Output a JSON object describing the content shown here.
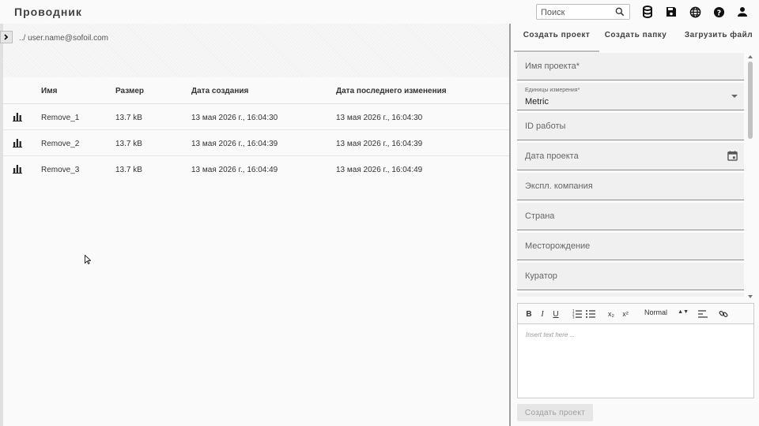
{
  "app": {
    "title": "Проводник"
  },
  "search": {
    "placeholder": "Поиск"
  },
  "header_icons": [
    "database-icon",
    "save-icon",
    "globe-icon",
    "help-icon",
    "account-icon"
  ],
  "breadcrumb": {
    "path": "../ user.name@sofoil.com"
  },
  "table": {
    "columns": [
      "Имя",
      "Размер",
      "Дата создания",
      "Дата последнего изменения"
    ],
    "rows": [
      {
        "name": "Remove_1",
        "size": "13.7 kB",
        "created": "13 мая 2026 г., 16:04:30",
        "modified": "13 мая 2026 г., 16:04:30"
      },
      {
        "name": "Remove_2",
        "size": "13.7 kB",
        "created": "13 мая 2026 г., 16:04:39",
        "modified": "13 мая 2026 г., 16:04:39"
      },
      {
        "name": "Remove_3",
        "size": "13.7 kB",
        "created": "13 мая 2026 г., 16:04:49",
        "modified": "13 мая 2026 г., 16:04:49"
      }
    ]
  },
  "tabs": [
    "Создать проект",
    "Создать папку",
    "Загрузить файл"
  ],
  "form": {
    "project_name_label": "Имя проекта*",
    "units_label": "Единицы измерения*",
    "units_value": "Metric",
    "job_id_label": "ID работы",
    "project_date_label": "Дата проекта",
    "operator_label": "Экспл. компания",
    "country_label": "Страна",
    "field_label": "Месторождение",
    "curator_label": "Куратор"
  },
  "editor": {
    "toolbar": {
      "bold": "B",
      "italic": "I",
      "underline": "U",
      "subscript": "x₂",
      "superscript": "x²",
      "size": "Normal"
    },
    "placeholder": "Insert text here ..."
  },
  "submit_label": "Создать проект",
  "colors": {
    "accent": "#424242",
    "divider": "#9e9e9e",
    "field_bg": "#f0f0f0"
  }
}
